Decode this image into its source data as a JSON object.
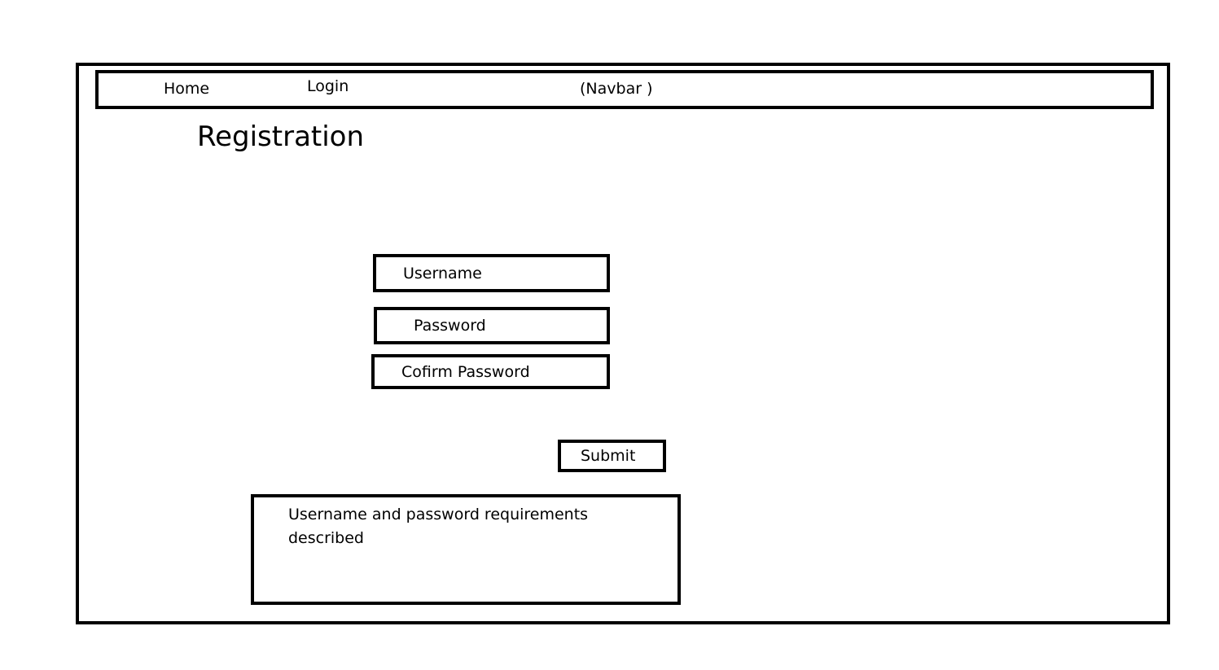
{
  "navbar": {
    "home_label": "Home",
    "login_label": "Login",
    "caption": "(Navbar )"
  },
  "page": {
    "title": "Registration"
  },
  "form": {
    "username_placeholder": "Username",
    "password_placeholder": "Password",
    "confirm_placeholder": "Cofirm Password",
    "submit_label": "Submit"
  },
  "requirements": {
    "text": "Username and password requirements described"
  }
}
